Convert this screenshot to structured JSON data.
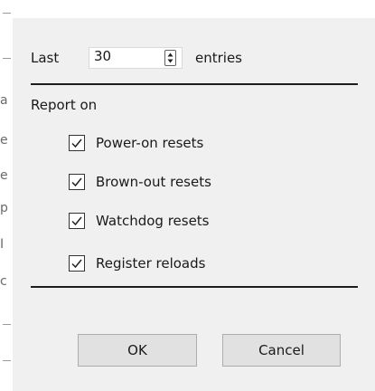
{
  "background": {
    "edge_glyphs": [
      "a",
      "e",
      "e",
      "p",
      "I",
      "c"
    ]
  },
  "dialog": {
    "last_label": "Last",
    "entries_value": "30",
    "entries_suffix": "entries",
    "report_on_label": "Report on",
    "options": [
      {
        "label": "Power-on resets",
        "checked": true
      },
      {
        "label": "Brown-out resets",
        "checked": true
      },
      {
        "label": "Watchdog resets",
        "checked": true
      },
      {
        "label": "Register reloads",
        "checked": true
      }
    ],
    "ok_label": "OK",
    "cancel_label": "Cancel"
  },
  "icons": {
    "checkbox": "checkmark-icon",
    "spinner": "spinner-arrows-icon"
  },
  "colors": {
    "dialog_bg": "#f0f0f0",
    "button_bg": "#e1e1e1",
    "divider": "#1e1e1e"
  }
}
